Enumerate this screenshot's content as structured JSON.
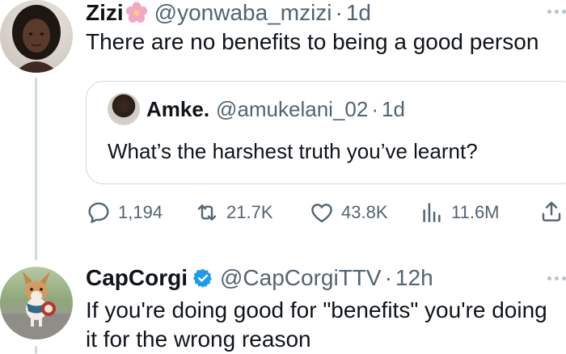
{
  "tweet1": {
    "name": "Zizi",
    "handle": "@yonwaba_mzizi",
    "separator": "·",
    "time": "1d",
    "text": "There are no benefits to being a good person"
  },
  "quote": {
    "name": "Amke.",
    "handle": "@amukelani_02",
    "separator": "·",
    "time": "1d",
    "text": "What’s the harshest truth you’ve learnt?"
  },
  "actions": {
    "replies": "1,194",
    "reposts": "21.7K",
    "likes": "43.8K",
    "views": "11.6M"
  },
  "tweet2": {
    "name": "CapCorgi",
    "handle": "@CapCorgiTTV",
    "separator": "·",
    "time": "12h",
    "text": "If you're doing good for \"benefits\" you're doing it for the wrong reason"
  },
  "colors": {
    "verified": "#1d9bf0",
    "muted": "#536471",
    "border": "#cfd9de"
  },
  "icons": [
    "cherry-blossom-icon",
    "more-icon",
    "reply-icon",
    "repost-icon",
    "like-icon",
    "views-icon",
    "share-icon",
    "verified-badge-icon"
  ]
}
